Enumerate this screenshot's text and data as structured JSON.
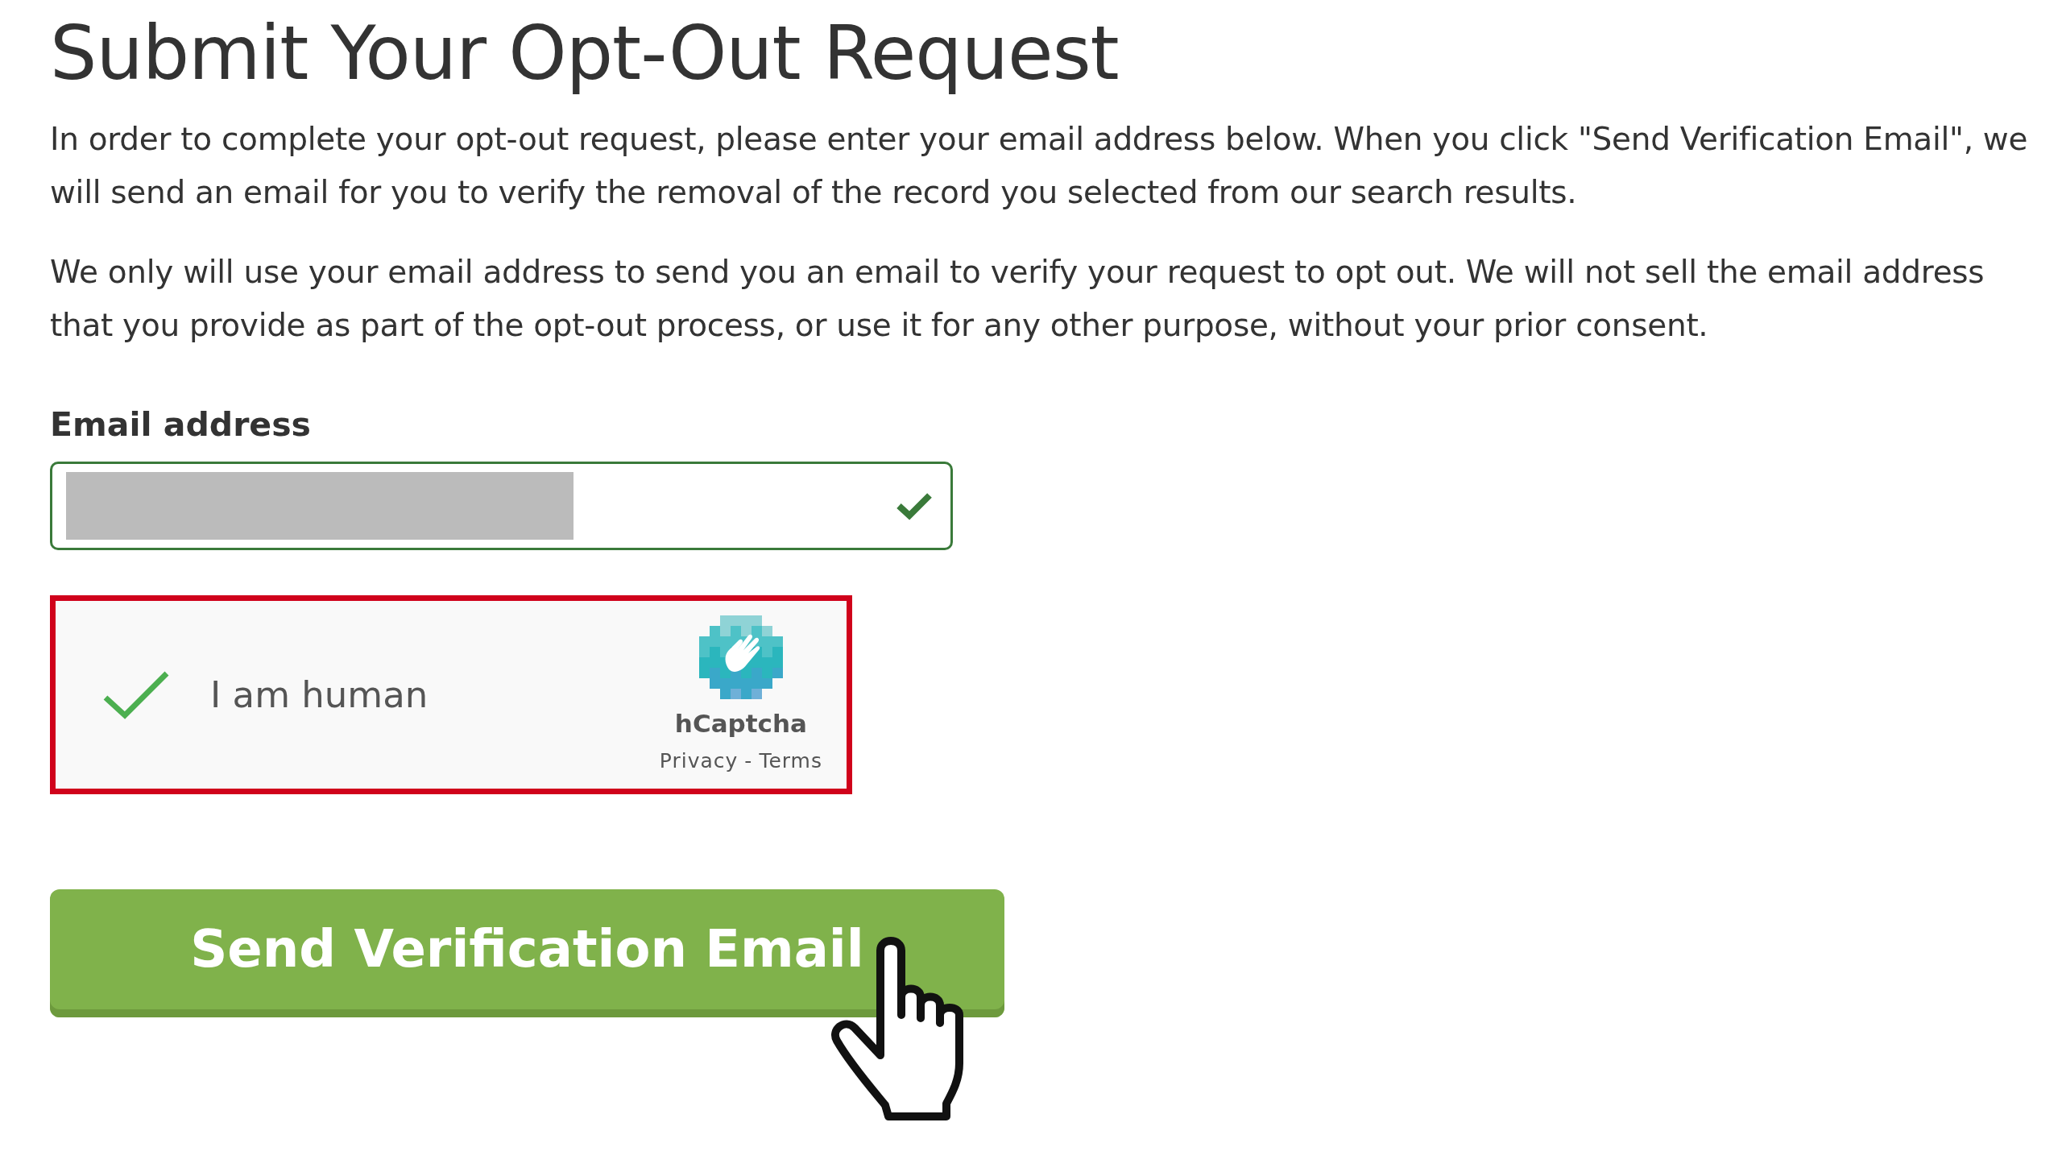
{
  "title": "Submit Your Opt-Out Request",
  "paragraphs": [
    "In order to complete your opt-out request, please enter your email address below. When you click \"Send Verification Email\", we will send an email for you to verify the removal of the record you selected from our search results.",
    "We only will use your email address to send you an email to verify your request to opt out. We will not sell the email address that you provide as part of the opt-out process, or use it for any other purpose, without your prior consent."
  ],
  "email": {
    "label": "Email address",
    "redacted": true,
    "valid": true
  },
  "captcha": {
    "label": "I am human",
    "checked": true,
    "brand": "hCaptcha",
    "links": [
      "Privacy",
      "Terms"
    ],
    "separator": "-"
  },
  "button": {
    "label": "Send Verification Email"
  }
}
